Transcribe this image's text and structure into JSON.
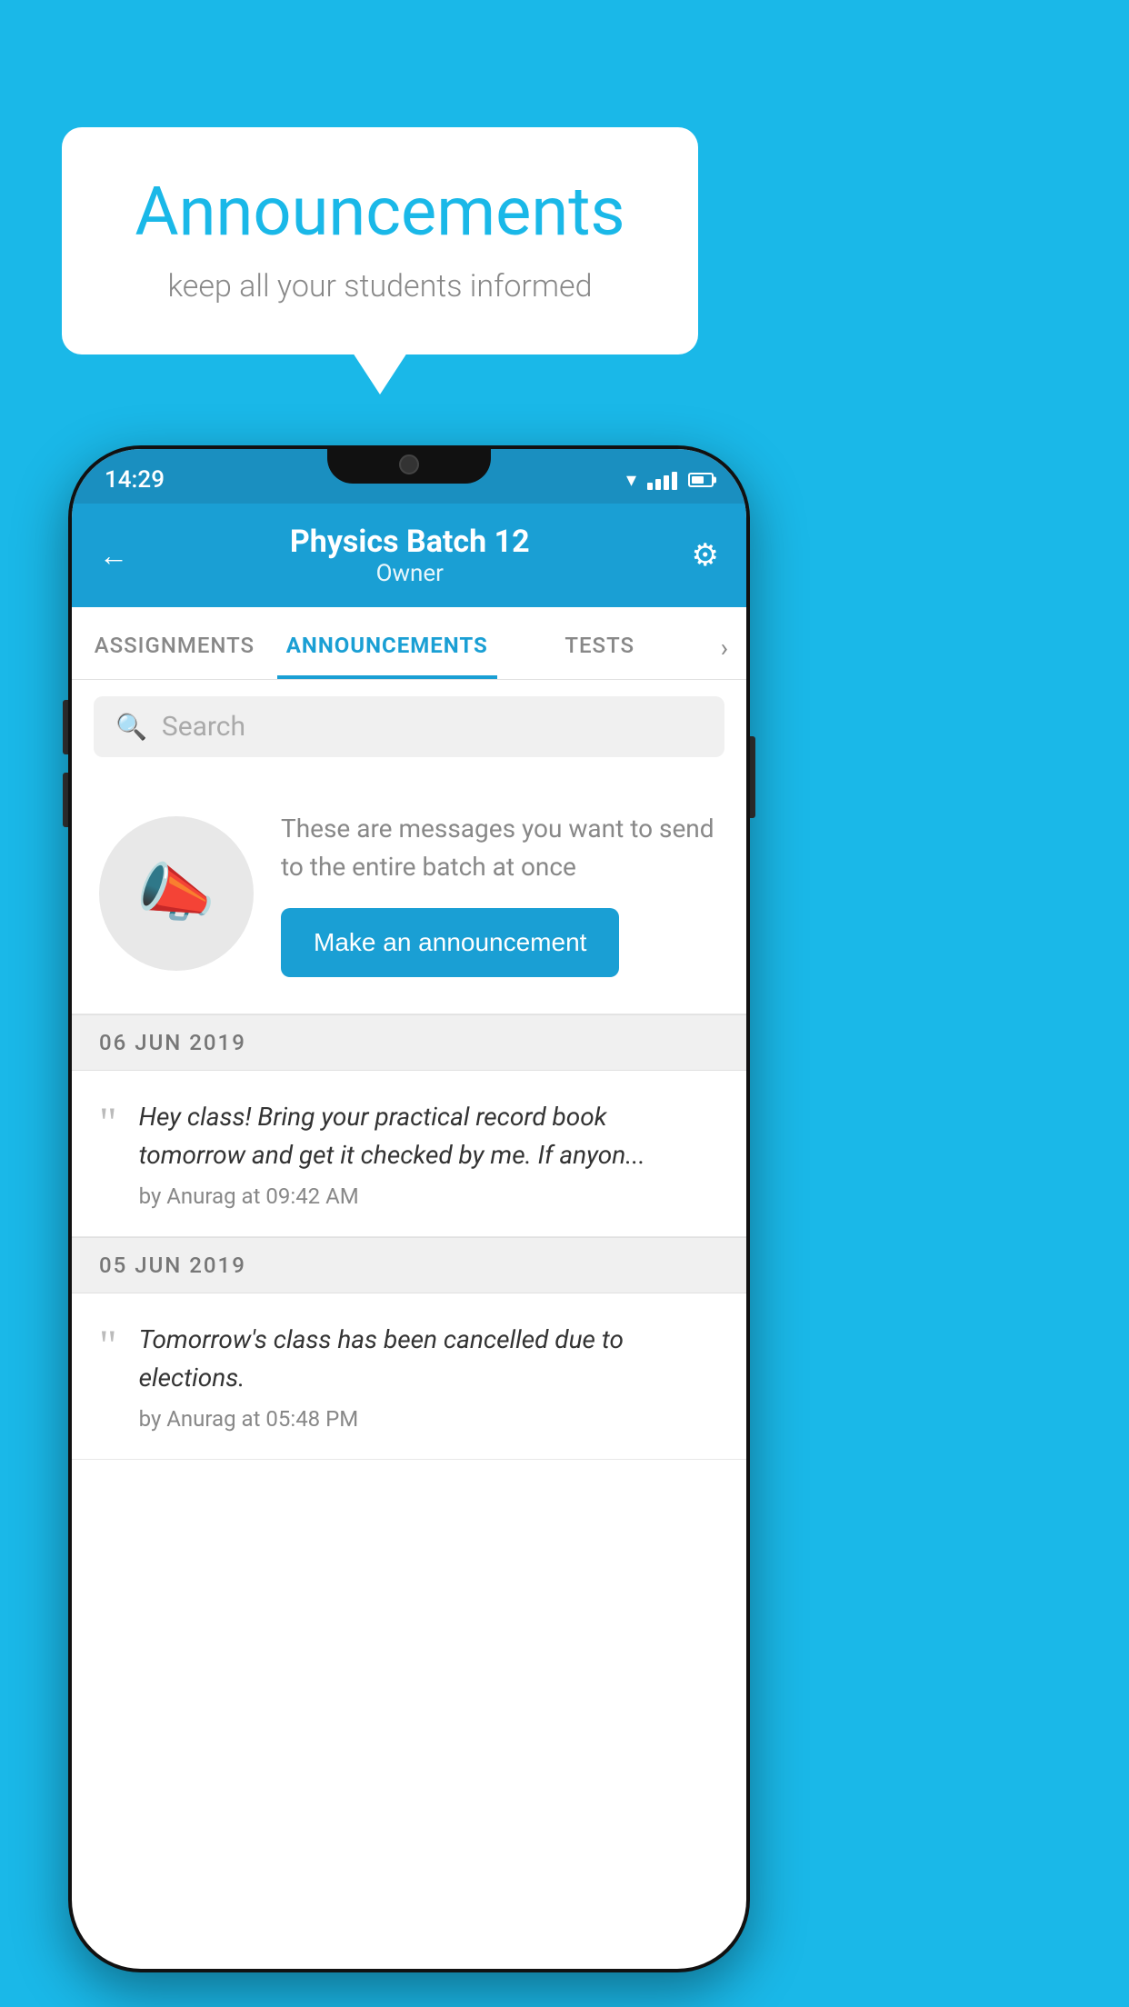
{
  "background_color": "#1ab8e8",
  "speech_bubble": {
    "title": "Announcements",
    "subtitle": "keep all your students informed"
  },
  "phone": {
    "status_bar": {
      "time": "14:29"
    },
    "header": {
      "title": "Physics Batch 12",
      "subtitle": "Owner",
      "back_label": "←",
      "gear_label": "⚙"
    },
    "tabs": [
      {
        "label": "ASSIGNMENTS",
        "active": false
      },
      {
        "label": "ANNOUNCEMENTS",
        "active": true
      },
      {
        "label": "TESTS",
        "active": false
      }
    ],
    "search": {
      "placeholder": "Search"
    },
    "announcement_cta": {
      "description": "These are messages you want to send to the entire batch at once",
      "button_label": "Make an announcement"
    },
    "announcements": [
      {
        "date": "06  JUN  2019",
        "text": "Hey class! Bring your practical record book tomorrow and get it checked by me. If anyon...",
        "meta": "by Anurag at 09:42 AM"
      },
      {
        "date": "05  JUN  2019",
        "text": "Tomorrow's class has been cancelled due to elections.",
        "meta": "by Anurag at 05:48 PM"
      }
    ]
  }
}
